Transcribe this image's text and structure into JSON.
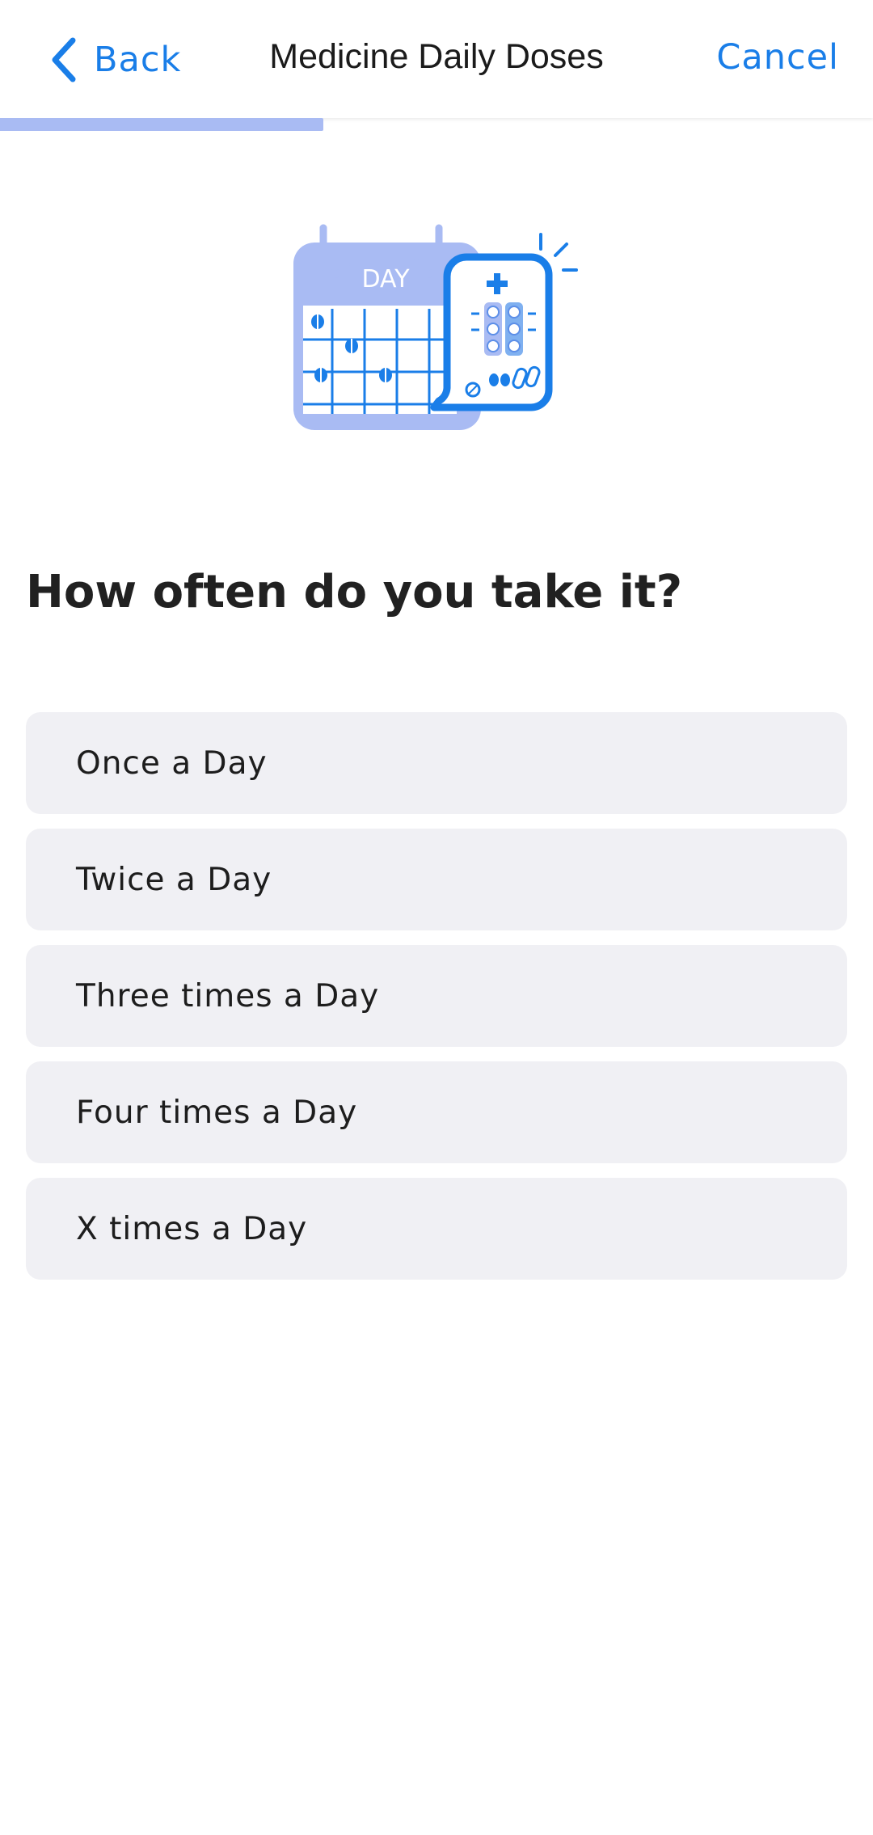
{
  "header": {
    "back_label": "Back",
    "title": "Medicine Daily Doses",
    "cancel_label": "Cancel"
  },
  "progress": {
    "fraction": 0.25
  },
  "illustration": {
    "calendar_label": "DAY",
    "icon": "calendar-medicine-icon"
  },
  "question": "How often do you take it?",
  "options": [
    {
      "label": "Once a Day"
    },
    {
      "label": "Twice a Day"
    },
    {
      "label": "Three times a Day"
    },
    {
      "label": "Four times a Day"
    },
    {
      "label": "X times a Day"
    }
  ],
  "colors": {
    "accent": "#1a7ee8",
    "light_accent": "#a9bbf3",
    "option_bg": "#f0f0f4",
    "text": "#212121"
  }
}
